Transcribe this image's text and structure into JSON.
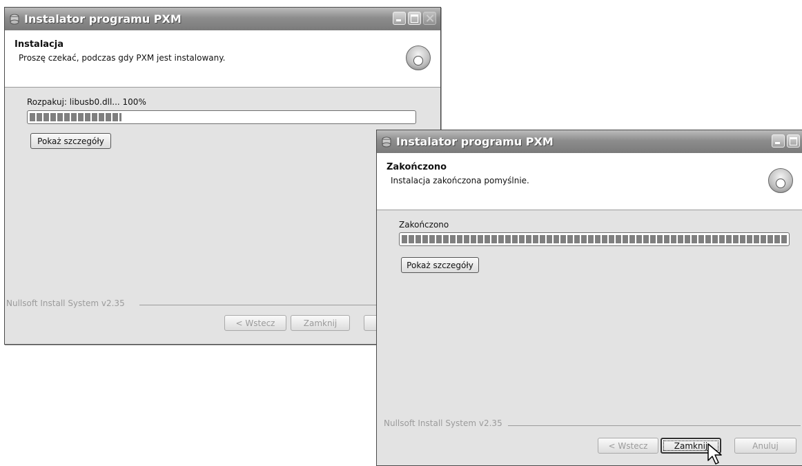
{
  "window1": {
    "title": "Instalator programu PXM",
    "header_title": "Instalacja",
    "header_subtitle": "Proszę czekać, podczas gdy PXM jest instalowany.",
    "status_text": "Rozpakuj: libusb0.dll... 100%",
    "progress": 0.24,
    "details_button": "Pokaż szczegóły",
    "branding": "Nullsoft Install System v2.35",
    "back_button": "< Wstecz",
    "close_button": "Zamknij"
  },
  "window2": {
    "title": "Instalator programu PXM",
    "header_title": "Zakończono",
    "header_subtitle": "Instalacja zakończona pomyślnie.",
    "status_text": "Zakończono",
    "progress": 1.0,
    "details_button": "Pokaż szczegóły",
    "branding": "Nullsoft Install System v2.35",
    "back_button": "< Wstecz",
    "close_button": "Zamknij",
    "cancel_button": "Anuluj"
  },
  "icons": {
    "title_icon": "installer-icon",
    "header_icon": "disk-install-icon",
    "cursor": "mouse-pointer-icon"
  }
}
